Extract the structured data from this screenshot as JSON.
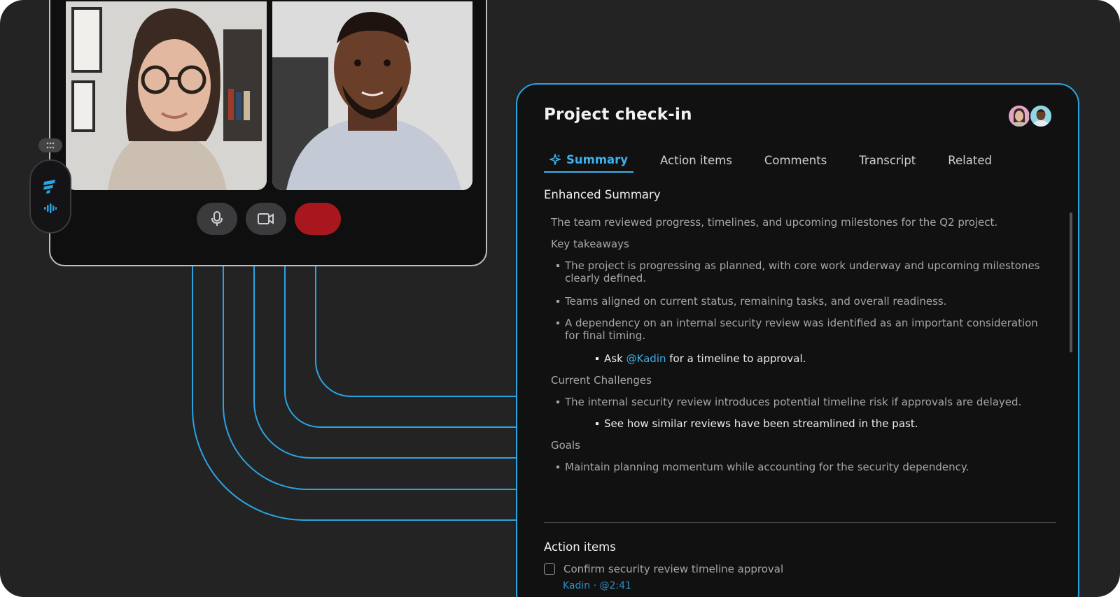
{
  "panel": {
    "title": "Project check-in",
    "tabs": [
      {
        "label": "Summary",
        "active": true
      },
      {
        "label": "Action items"
      },
      {
        "label": "Comments"
      },
      {
        "label": "Transcript"
      },
      {
        "label": "Related"
      }
    ]
  },
  "summary": {
    "heading": "Enhanced Summary",
    "intro": "The team reviewed progress, timelines, and upcoming milestones for the Q2 project.",
    "key_takeaways_label": "Key takeaways",
    "takeaways": [
      "The project is progressing as planned, with core work underway and upcoming milestones clearly defined.",
      "Teams aligned on current status, remaining tasks, and overall readiness.",
      "A dependency on an internal security review was identified as an important consideration for final timing."
    ],
    "sub_ask_prefix": "Ask ",
    "sub_ask_mention": "@Kadin",
    "sub_ask_suffix": " for a timeline to approval.",
    "challenges_label": "Current Challenges",
    "challenges": [
      "The internal security review introduces potential timeline risk if approvals are delayed."
    ],
    "sub_challenge": "See how similar reviews have been streamlined in the past.",
    "goals_label": "Goals",
    "goals": [
      "Maintain planning momentum while accounting for the security dependency."
    ]
  },
  "action_items": {
    "heading": "Action items",
    "items": [
      {
        "text": "Confirm security review timeline approval",
        "meta": "Kadin · @2:41"
      }
    ]
  },
  "colors": {
    "accent": "#3fb0ea",
    "end_call": "#a8171d",
    "panel_border": "#2aa4e0"
  }
}
